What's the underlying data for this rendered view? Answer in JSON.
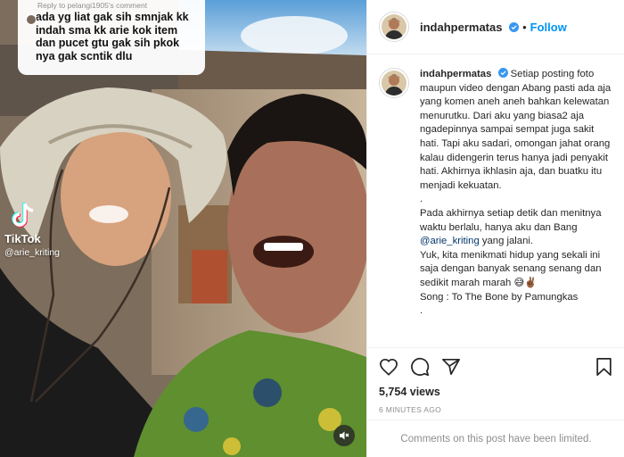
{
  "media": {
    "reply_label": "Reply to pelangi1905's comment",
    "reply_text": "ada yg liat gak sih smnjak kk\nindah sma kk arie kok item\ndan pucet gtu gak sih pkok\nnya gak scntik dlu",
    "tiktok_word": "TikTok",
    "tiktok_handle": "@arie_kriting",
    "audio_icon": "speaker-muted-icon"
  },
  "post": {
    "username": "indahpermatas",
    "verified": true,
    "separator": "•",
    "follow_label": "Follow",
    "caption_username": "indahpermatas",
    "caption_part1": "Setiap posting foto maupun video dengan Abang pasti ada aja yang komen aneh aneh bahkan kelewatan menurutku. Dari aku yang biasa2 aja ngadepinnya sampai sempat juga sakit hati. Tapi aku sadari, omongan jahat orang kalau didengerin terus hanya jadi penyakit hati. Akhirnya ikhlasin aja, dan buatku itu menjadi kekuatan.\n.\nPada akhirnya setiap detik dan menitnya waktu berlalu, hanya aku dan Bang ",
    "caption_mention": "@arie_kriting",
    "caption_part2": " yang jalani.\nYuk, kita menikmati hidup yang sekali ini saja dengan banyak senang senang dan sedikit marah marah 😅✌🏾\nSong : To The Bone by Pamungkas\n.",
    "views": "5,754 views",
    "time": "6 MINUTES AGO",
    "comments_disabled": "Comments on this post have been limited.",
    "accent_color": "#0095f6"
  }
}
